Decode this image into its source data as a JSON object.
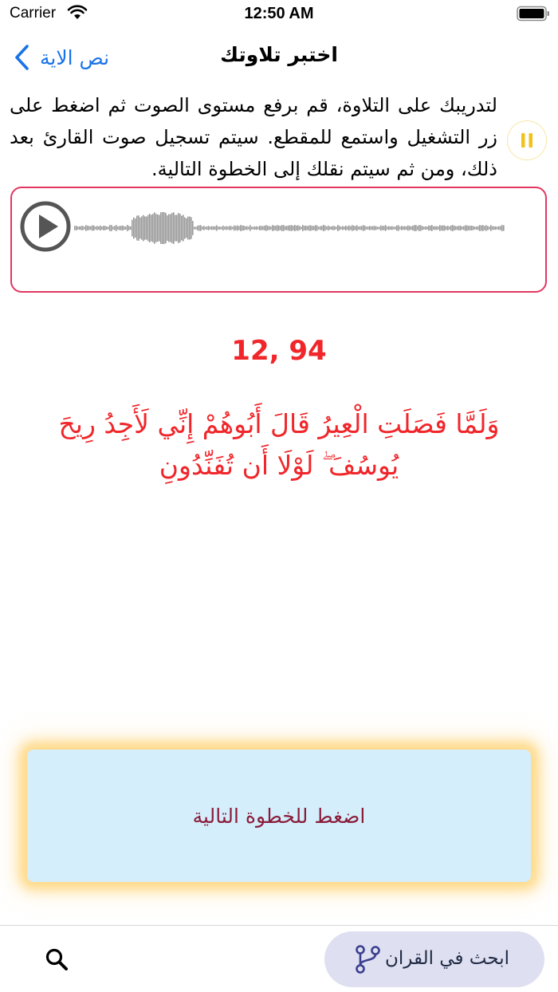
{
  "status_bar": {
    "carrier": "Carrier",
    "time": "12:50 AM"
  },
  "nav": {
    "back_label": "نص الاية",
    "title": "اختبر تلاوتك"
  },
  "instructions": {
    "text": "لتدريبك على التلاوة، قم برفع مستوى الصوت ثم اضغط على زر التشغيل واستمع للمقطع. سيتم تسجيل صوت القارئ بعد ذلك، ومن ثم سيتم نقلك إلى الخطوة التالية."
  },
  "player": {
    "play_icon": "play-icon",
    "pause_icon": "pause-icon"
  },
  "verse": {
    "reference": "12, 94",
    "text": "وَلَمَّا فَصَلَتِ الْعِيرُ قَالَ أَبُوهُمْ إِنِّي لَأَجِدُ رِيحَ يُوسُفَ ۖ لَوْلَا أَن تُفَنِّدُونِ"
  },
  "next_step": {
    "label": "اضغط للخطوة التالية"
  },
  "bottom_bar": {
    "search_icon": "search-icon",
    "quran_search_label": "ابحث في القران",
    "branch_icon": "branch-icon"
  },
  "colors": {
    "accent_blue": "#1a73e8",
    "verse_red": "#f0262a",
    "player_border": "#e3365f",
    "next_bg": "#d4eefb",
    "next_text": "#8b1c3a",
    "pill_bg": "#dedff0",
    "glow": "#ffc446"
  }
}
